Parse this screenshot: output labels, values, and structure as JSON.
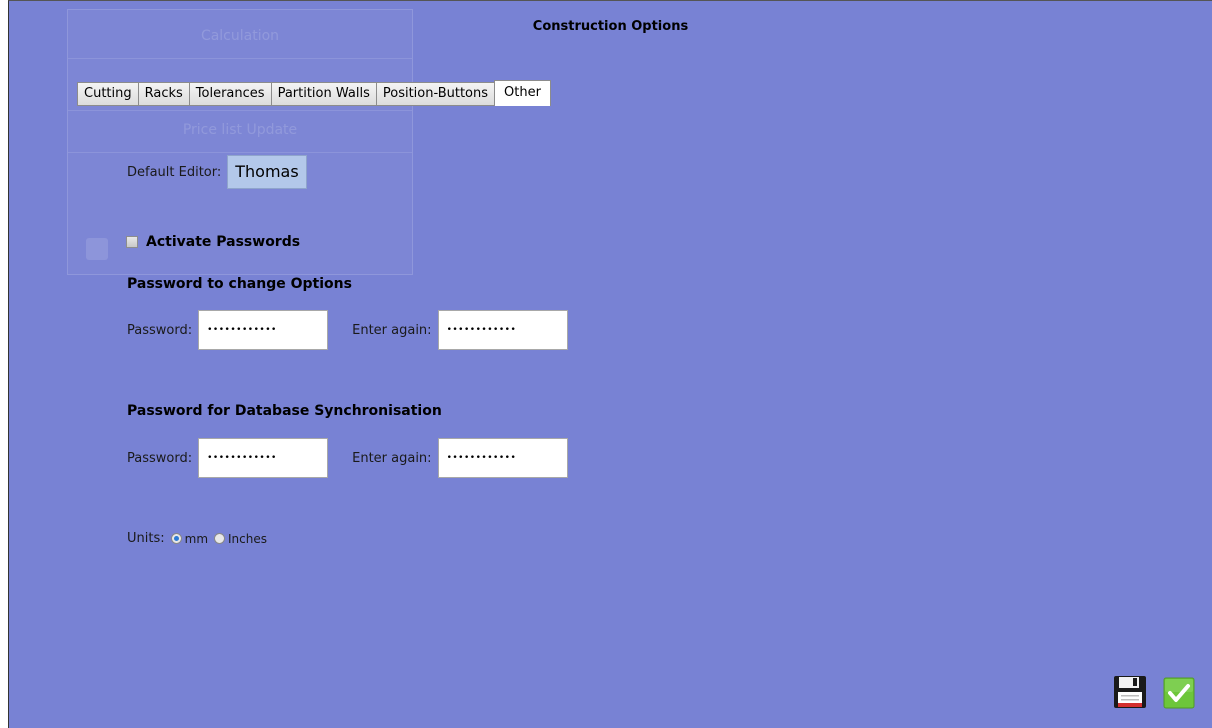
{
  "dialog": {
    "title": "Construction Options"
  },
  "background_window": {
    "title": "Calculation",
    "subtitle": "Price list Update"
  },
  "tabs": [
    {
      "label": "Cutting",
      "active": false
    },
    {
      "label": "Racks",
      "active": false
    },
    {
      "label": "Tolerances",
      "active": false
    },
    {
      "label": "Partition Walls",
      "active": false
    },
    {
      "label": "Position-Buttons",
      "active": false
    },
    {
      "label": "Other",
      "active": true
    }
  ],
  "other": {
    "default_editor_label": "Default Editor:",
    "default_editor_value": "Thomas",
    "activate_passwords_label": "Activate Passwords",
    "activate_passwords_checked": false,
    "options_section": {
      "heading": "Password to change Options",
      "password_label": "Password:",
      "password_value": "••••••••••••",
      "again_label": "Enter again:",
      "again_value": "••••••••••••"
    },
    "sync_section": {
      "heading": "Password for Database Synchronisation",
      "password_label": "Password:",
      "password_value": "••••••••••••",
      "again_label": "Enter again:",
      "again_value": "••••••••••••"
    },
    "units": {
      "label": "Units:",
      "options": [
        "mm",
        "Inches"
      ],
      "selected": "mm"
    }
  },
  "footer": {
    "save_icon": "floppy-disk-icon",
    "ok_icon": "green-checkmark-icon"
  },
  "colors": {
    "background": "#7882d4",
    "editor_highlight": "#b3c8ea",
    "confirm_green": "#6dc63a"
  }
}
